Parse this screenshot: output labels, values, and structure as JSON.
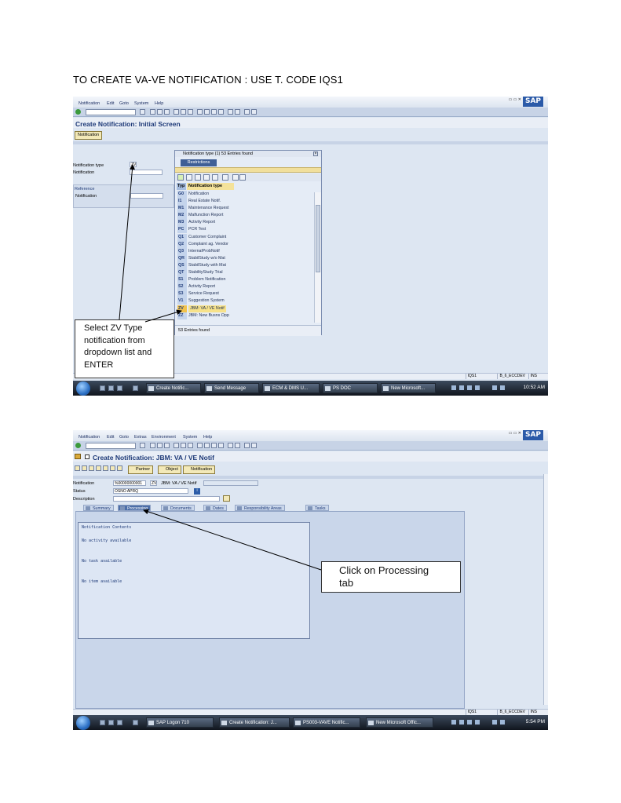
{
  "page": {
    "heading": "TO CREATE VA-VE NOTIFICATION :  USE T. CODE IQS1"
  },
  "shot1": {
    "menu": [
      "Notification",
      "Edit",
      "Goto",
      "System",
      "Help"
    ],
    "sap_logo": "SAP",
    "title": "Create Notification: Initial Screen",
    "app_button": "Notification",
    "labels": {
      "notification_type": "Notification type",
      "notification": "Notification",
      "reference": "Reference",
      "ref_notification": "Notification"
    },
    "notification_type_value": "ZV",
    "popup": {
      "title": "Notification type (1)   53 Entries found",
      "restrictions_tab": "Restrictions",
      "col_type": "Typ",
      "col_desc": "Notification type",
      "rows": [
        {
          "code": "G0",
          "desc": "Notification"
        },
        {
          "code": "I1",
          "desc": "Real Estate Notif."
        },
        {
          "code": "M1",
          "desc": "Maintenance Request"
        },
        {
          "code": "M2",
          "desc": "Malfunction Report"
        },
        {
          "code": "M3",
          "desc": "Activity Report"
        },
        {
          "code": "PC",
          "desc": "PCR Test"
        },
        {
          "code": "Q1",
          "desc": "Customer Complaint"
        },
        {
          "code": "Q2",
          "desc": "Complaint ag. Vendor"
        },
        {
          "code": "Q3",
          "desc": "InternalProbNotif"
        },
        {
          "code": "QR",
          "desc": "StabilStudy w/o Mat"
        },
        {
          "code": "QS",
          "desc": "StabilStudy with Mat"
        },
        {
          "code": "QT",
          "desc": "StabilityStudy Trial"
        },
        {
          "code": "S1",
          "desc": "Problem Notification"
        },
        {
          "code": "S2",
          "desc": "Activity Report"
        },
        {
          "code": "S3",
          "desc": "Service Request"
        },
        {
          "code": "V1",
          "desc": "Suggestion System"
        },
        {
          "code": "ZV",
          "desc": "JBM: VA / VE Notif"
        },
        {
          "code": "ZZ",
          "desc": "JBM: New Busns Opp"
        }
      ],
      "status": "53 Entries found"
    },
    "status": {
      "tcode": "IQS1",
      "server": "B_6_ECCDEV",
      "mode": "INS"
    },
    "taskbar": {
      "items": [
        "Create Notific...",
        "Send Message",
        "ECM & DMS U...",
        "PS DOC",
        "New Microsoft..."
      ],
      "clock": "10:52 AM"
    }
  },
  "callout1": {
    "lines": [
      "Select ZV Type",
      "notification from",
      "dropdown list and",
      "ENTER"
    ]
  },
  "shot2": {
    "menu": [
      "Notification",
      "Edit",
      "Goto",
      "Extras",
      "Environment",
      "System",
      "Help"
    ],
    "sap_logo": "SAP",
    "title": "Create Notification: JBM: VA / VE Notif",
    "app_buttons": [
      "Partner",
      "Object",
      "Notification"
    ],
    "labels": {
      "notification": "Notification",
      "status": "Status",
      "description": "Description"
    },
    "notification_number": "%00000000001",
    "notification_type": "ZV",
    "notification_type_text": "JBM: VA / VE Notif",
    "status_value": "OSNO APRQ",
    "tabs": [
      "Summary",
      "Processing",
      "Documents",
      "Dates",
      "Responsibility Areas",
      "Tasks"
    ],
    "contents": {
      "header": "Notification Contents",
      "lines": [
        "No activity available",
        "No task available",
        "No item available"
      ]
    },
    "status": {
      "tcode": "IQS1",
      "server": "B_6_ECCDEV",
      "mode": "INS"
    },
    "taskbar": {
      "items": [
        "SAP Logon 710",
        "Create Notification: J...",
        "PS003-VAVE Notific...",
        "New Microsoft Offic..."
      ],
      "clock": "5:54 PM"
    }
  },
  "callout2": {
    "lines": [
      "Click on Processing",
      "tab"
    ]
  },
  "colors": {
    "sap_title": "#1e3a78",
    "app_button": "#f3e9b8",
    "selected_row": "#f7e28a",
    "screen_bg": "#dde6f2"
  }
}
